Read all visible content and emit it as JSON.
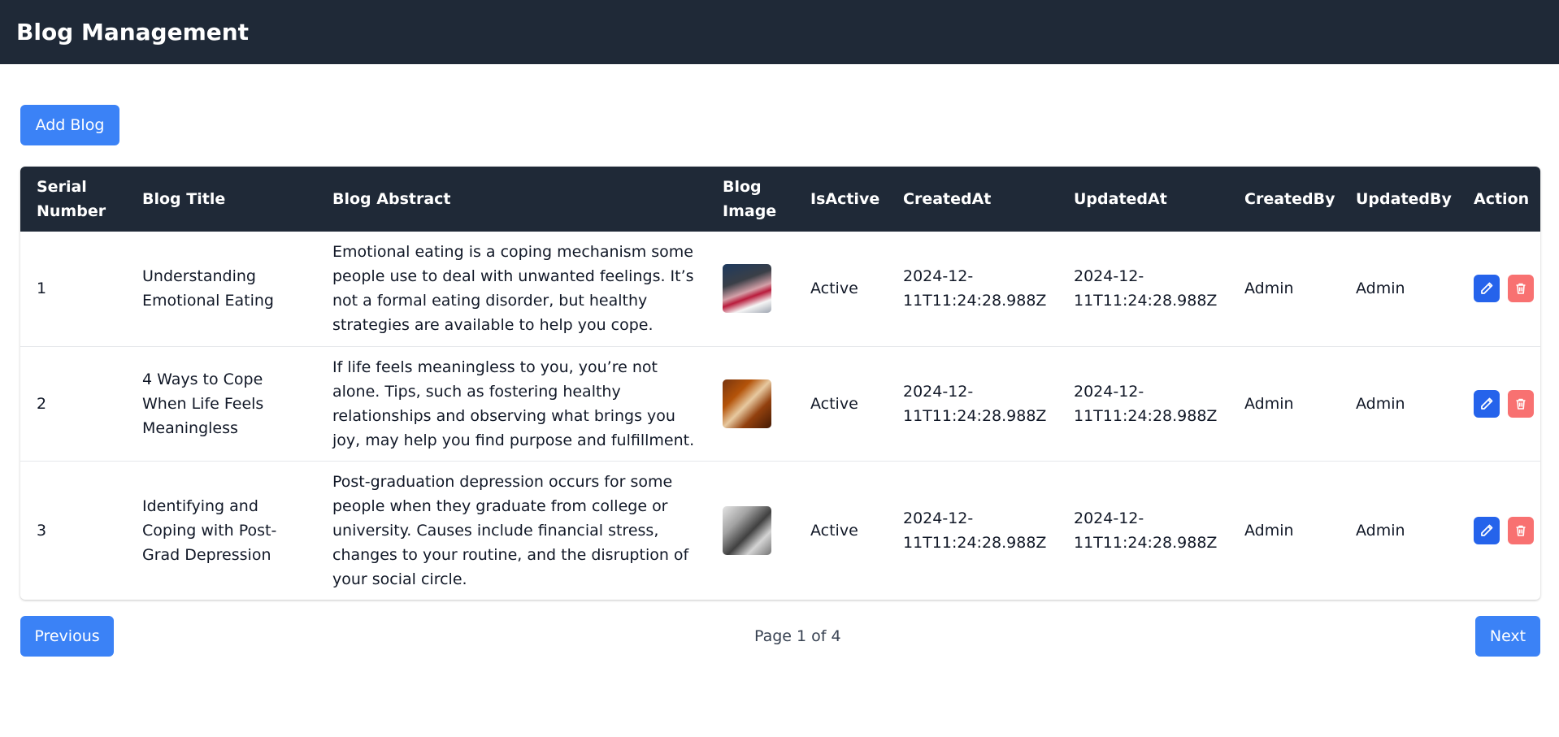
{
  "header": {
    "title": "Blog Management"
  },
  "toolbar": {
    "add_label": "Add Blog"
  },
  "table": {
    "columns": [
      "Serial Number",
      "Blog Title",
      "Blog Abstract",
      "Blog Image",
      "IsActive",
      "CreatedAt",
      "UpdatedAt",
      "CreatedBy",
      "UpdatedBy",
      "Action"
    ],
    "rows": [
      {
        "serial": "1",
        "title": "Understanding Emotional Eating",
        "abstract": "Emotional eating is a coping mechanism some people use to deal with unwanted feelings. It’s not a formal eating disorder, but healthy strategies are available to help you cope.",
        "is_active": "Active",
        "created_at": "2024-12-11T11:24:28.988Z",
        "updated_at": "2024-12-11T11:24:28.988Z",
        "created_by": "Admin",
        "updated_by": "Admin"
      },
      {
        "serial": "2",
        "title": "4 Ways to Cope When Life Feels Meaningless",
        "abstract": "If life feels meaningless to you, you’re not alone. Tips, such as fostering healthy relationships and observing what brings you joy, may help you find purpose and fulfillment.",
        "is_active": "Active",
        "created_at": "2024-12-11T11:24:28.988Z",
        "updated_at": "2024-12-11T11:24:28.988Z",
        "created_by": "Admin",
        "updated_by": "Admin"
      },
      {
        "serial": "3",
        "title": "Identifying and Coping with Post-Grad Depression",
        "abstract": "Post-graduation depression occurs for some people when they graduate from college or university. Causes include financial stress, changes to your routine, and the disruption of your social circle.",
        "is_active": "Active",
        "created_at": "2024-12-11T11:24:28.988Z",
        "updated_at": "2024-12-11T11:24:28.988Z",
        "created_by": "Admin",
        "updated_by": "Admin"
      }
    ]
  },
  "pagination": {
    "previous_label": "Previous",
    "next_label": "Next",
    "page_info": "Page 1 of 4"
  },
  "icons": {
    "edit": "pencil-icon",
    "delete": "trash-icon"
  },
  "colors": {
    "header_bg": "#1f2937",
    "primary": "#3b82f6",
    "edit": "#2563eb",
    "delete": "#f87171"
  }
}
